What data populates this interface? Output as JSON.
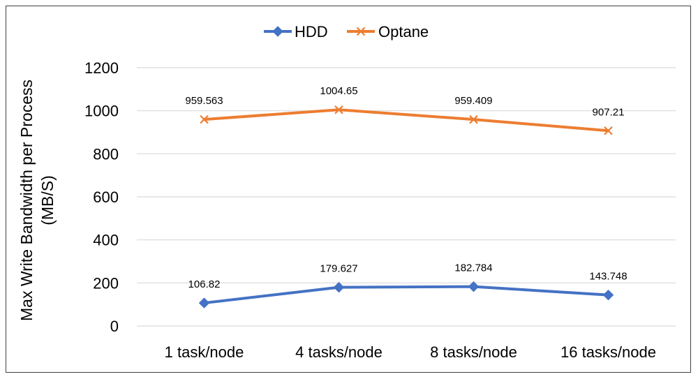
{
  "chart_data": {
    "type": "line",
    "categories": [
      "1 task/node",
      "4 tasks/node",
      "8 tasks/node",
      "16 tasks/node"
    ],
    "series": [
      {
        "name": "HDD",
        "values": [
          106.82,
          179.627,
          182.784,
          143.748
        ],
        "labels": [
          "106.82",
          "179.627",
          "182.784",
          "143.748"
        ],
        "color": "#4472C4",
        "marker": "diamond"
      },
      {
        "name": "Optane",
        "values": [
          959.563,
          1004.65,
          959.409,
          907.21
        ],
        "labels": [
          "959.563",
          "1004.65",
          "959.409",
          "907.21"
        ],
        "color": "#ED7D31",
        "marker": "x"
      }
    ],
    "title": "",
    "xlabel": "",
    "ylabel": [
      "Max Write Bandwidth per Process",
      "(MB/S)"
    ],
    "ylim": [
      0,
      1200
    ],
    "yticks": [
      0,
      200,
      400,
      600,
      800,
      1000,
      1200
    ],
    "grid": true,
    "legend": "top-center",
    "colors": {
      "grid": "#D9D9D9",
      "frame": "#404040"
    }
  }
}
